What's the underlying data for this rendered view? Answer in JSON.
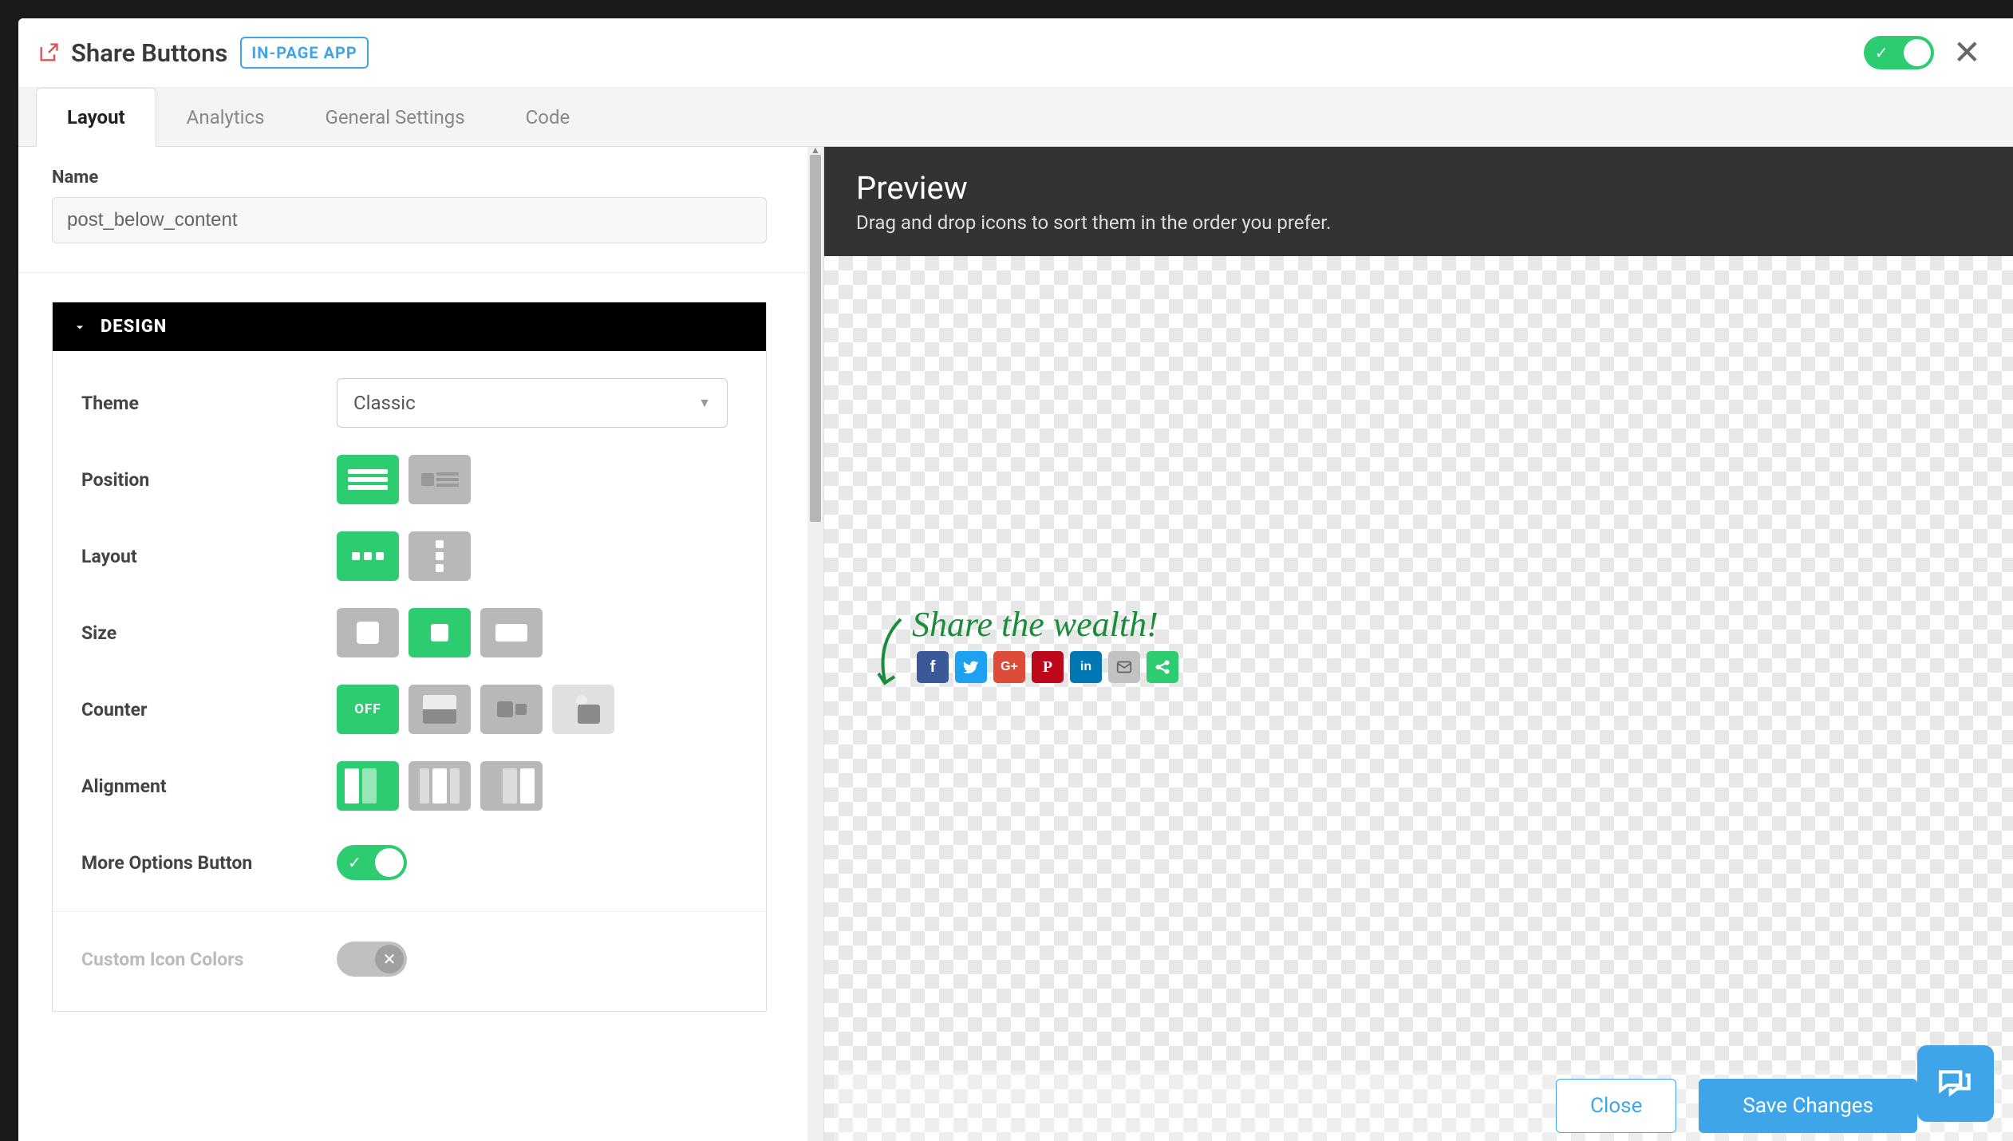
{
  "header": {
    "title": "Share Buttons",
    "badge": "IN-PAGE APP",
    "enabled": true
  },
  "tabs": [
    {
      "id": "layout",
      "label": "Layout",
      "active": true
    },
    {
      "id": "analytics",
      "label": "Analytics",
      "active": false
    },
    {
      "id": "general",
      "label": "General Settings",
      "active": false
    },
    {
      "id": "code",
      "label": "Code",
      "active": false
    }
  ],
  "form": {
    "name_label": "Name",
    "name_value": "post_below_content",
    "sections": {
      "design": {
        "title": "DESIGN",
        "theme_label": "Theme",
        "theme_value": "Classic",
        "position_label": "Position",
        "layout_label": "Layout",
        "size_label": "Size",
        "counter_label": "Counter",
        "counter_off": "OFF",
        "alignment_label": "Alignment",
        "more_options_label": "More Options Button",
        "more_options_value": true,
        "custom_colors_label": "Custom Icon Colors",
        "custom_colors_value": false
      }
    }
  },
  "preview": {
    "title": "Preview",
    "subtitle": "Drag and drop icons to sort them in the order you prefer.",
    "heading": "Share the wealth!",
    "icons": [
      {
        "id": "facebook",
        "glyph": "f",
        "color": "#3b5998"
      },
      {
        "id": "twitter",
        "glyph": "t",
        "color": "#1da1f2"
      },
      {
        "id": "googleplus",
        "glyph": "G+",
        "color": "#dd4b39"
      },
      {
        "id": "pinterest",
        "glyph": "P",
        "color": "#bd081c"
      },
      {
        "id": "linkedin",
        "glyph": "in",
        "color": "#0077b5"
      },
      {
        "id": "email",
        "glyph": "mail",
        "color": "#c2c2c2"
      },
      {
        "id": "more",
        "glyph": "more",
        "color": "#2ecc71"
      }
    ]
  },
  "footer": {
    "close": "Close",
    "save": "Save Changes"
  }
}
